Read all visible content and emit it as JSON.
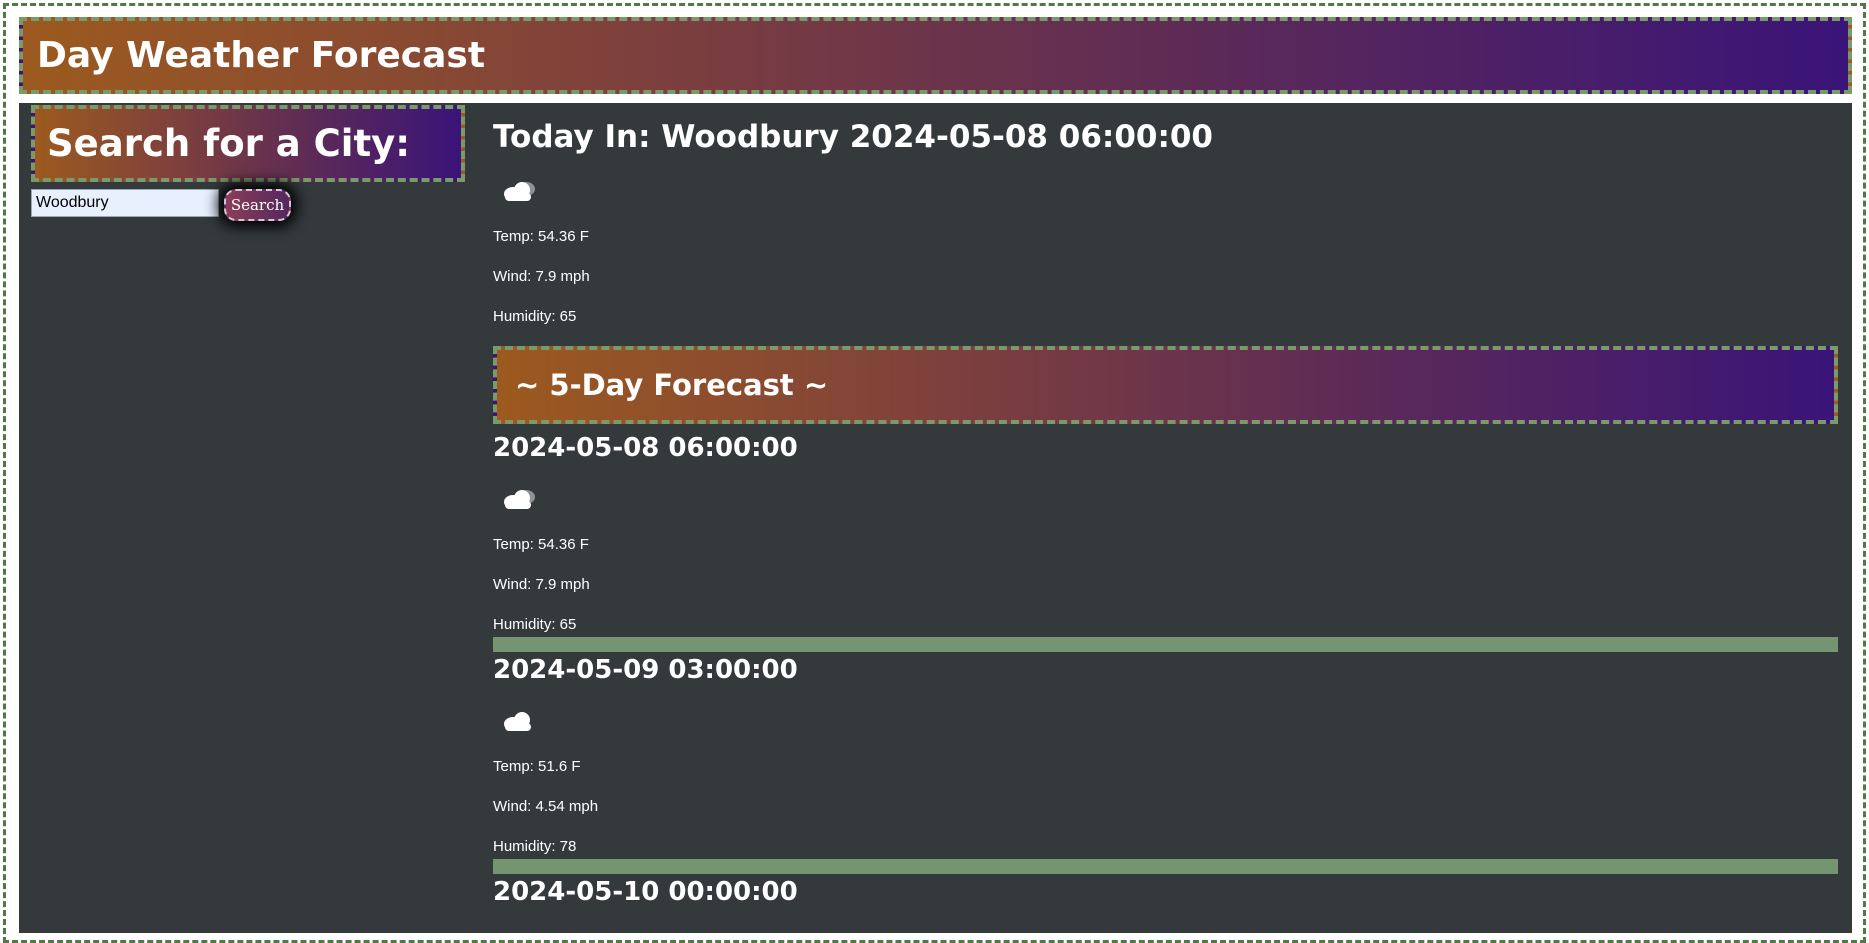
{
  "header": {
    "title": "Day Weather Forecast"
  },
  "search": {
    "heading": "Search for a City:",
    "input_value": "Woodbury",
    "button_label": "Search"
  },
  "today": {
    "title": "Today In: Woodbury 2024-05-08 06:00:00",
    "icon": "cloud-icon",
    "temp": "Temp: 54.36 F",
    "wind": "Wind: 7.9 mph",
    "humidity": "Humidity: 65"
  },
  "forecast": {
    "heading": "~ 5-Day Forecast ~",
    "days": [
      {
        "date": "2024-05-08 06:00:00",
        "icon": "cloud-icon",
        "temp": "Temp: 54.36 F",
        "wind": "Wind: 7.9 mph",
        "humidity": "Humidity: 65"
      },
      {
        "date": "2024-05-09 03:00:00",
        "icon": "cloud-icon",
        "temp": "Temp: 51.6 F",
        "wind": "Wind: 4.54 mph",
        "humidity": "Humidity: 78"
      },
      {
        "date": "2024-05-10 00:00:00"
      }
    ]
  },
  "colors": {
    "gradient_start": "#9c5a1f",
    "gradient_end": "#3a1478",
    "panel_bg": "#343a3c",
    "divider": "#759572",
    "dashed_border": "#4f7a45"
  }
}
